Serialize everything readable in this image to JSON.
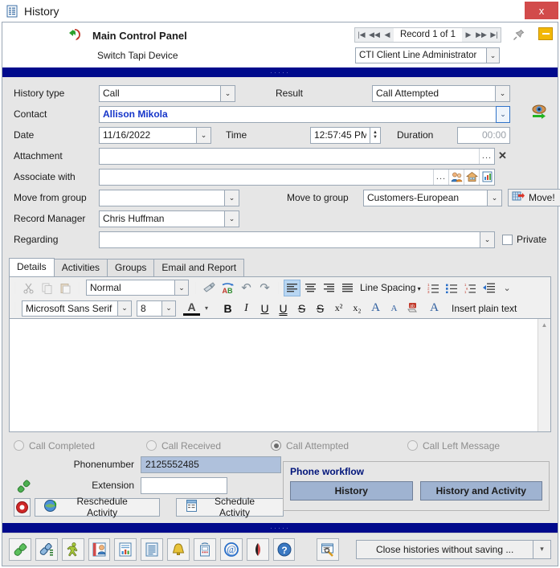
{
  "window": {
    "title": "History",
    "icon": "document-history-icon",
    "close_label": "x"
  },
  "header": {
    "title": "Main Control Panel",
    "subtitle": "Switch Tapi Device",
    "phone_icon": "green-phone-arrow-icon",
    "record_nav": {
      "first": "|◀",
      "prev_page": "◀◀",
      "prev": "◀",
      "label": "Record 1 of 1",
      "next": "▶",
      "next_page": "▶▶",
      "last": "▶|"
    },
    "pin_icon": "pushpin-icon",
    "minimize_icon": "minimize-icon",
    "device_select": {
      "value": "CTI Client Line Administrator",
      "placeholder": ""
    }
  },
  "form": {
    "history_type": {
      "label": "History type",
      "value": "Call"
    },
    "result": {
      "label": "Result",
      "value": "Call Attempted"
    },
    "contact": {
      "label": "Contact",
      "value": "Allison Mikola"
    },
    "date": {
      "label": "Date",
      "value": "11/16/2022"
    },
    "time": {
      "label": "Time",
      "value": "12:57:45 PM"
    },
    "duration": {
      "label": "Duration",
      "value": "00:00"
    },
    "attachment": {
      "label": "Attachment",
      "value": "",
      "browse": "...",
      "clear": "✕"
    },
    "associate_with": {
      "label": "Associate with",
      "value": "",
      "browse": "..."
    },
    "move_from_group": {
      "label": "Move from group",
      "value": ""
    },
    "move_to_group": {
      "label": "Move to group",
      "value": "Customers-European"
    },
    "move_button": {
      "label": "Move!",
      "icon": "move-grid-icon"
    },
    "record_manager": {
      "label": "Record Manager",
      "value": "Chris Huffman"
    },
    "regarding": {
      "label": "Regarding",
      "value": ""
    },
    "private": {
      "label": "Private",
      "checked": false
    },
    "eye_icon": "eye-forward-icon"
  },
  "tabs": [
    {
      "label": "Details",
      "active": true
    },
    {
      "label": "Activities",
      "active": false
    },
    {
      "label": "Groups",
      "active": false
    },
    {
      "label": "Email and Report",
      "active": false
    }
  ],
  "editor_toolbar": {
    "cut": "✂",
    "copy": "copy-icon",
    "paste": "paste-icon",
    "style": "Normal",
    "format_painter": "format-painter-icon",
    "spellcheck": "spellcheck-icon",
    "undo": "↶",
    "redo": "↷",
    "align_left": "align-left-icon",
    "align_center": "align-center-icon",
    "align_right": "align-right-icon",
    "align_justify": "align-justify-icon",
    "line_spacing": "Line Spacing",
    "numbered_list": "numbered-list-icon",
    "bullet_list": "bullet-list-icon",
    "multilevel_list": "multilevel-list-icon",
    "indent": "indent-icon",
    "overflow": "⌄",
    "font_family": "Microsoft Sans Serif",
    "font_size": "8",
    "font_color": "A",
    "bold": "B",
    "italic": "I",
    "underline": "U",
    "double_underline": "U",
    "strikethrough": "S",
    "double_strikethrough": "S",
    "superscript": "x²",
    "subscript": "x₂",
    "grow_font": "A",
    "shrink_font": "A",
    "highlight": "highlight-icon",
    "clear_format": "A",
    "insert_plain_text": "Insert plain text"
  },
  "editor": {
    "content": ""
  },
  "call_options": [
    {
      "label": "Call Completed",
      "selected": false
    },
    {
      "label": "Call Received",
      "selected": false
    },
    {
      "label": "Call Attempted",
      "selected": true
    },
    {
      "label": "Call Left Message",
      "selected": false
    }
  ],
  "phone": {
    "number_label": "Phonenumber",
    "number_value": "2125552485",
    "extension_label": "Extension",
    "extension_value": "",
    "handset_icon": "green-handset-icon",
    "cancel_icon": "red-stop-icon",
    "reschedule": {
      "label": "Reschedule Activity",
      "icon": "reschedule-globe-icon"
    },
    "schedule": {
      "label": "Schedule Activity",
      "icon": "schedule-calendar-icon"
    }
  },
  "workflow": {
    "title": "Phone workflow",
    "buttons": [
      {
        "label": "History"
      },
      {
        "label": "History and Activity"
      }
    ]
  },
  "bottom_toolbar": {
    "icons": [
      "phone-icon",
      "phone-dial-icon",
      "person-walking-icon",
      "contact-card-icon",
      "report-icon",
      "document-icon",
      "bell-icon",
      "fax-icon",
      "email-icon",
      "pen-icon",
      "help-icon"
    ],
    "search_icon": "lookup-icon",
    "close_action": {
      "label": "Close histories without saving ...",
      "arrow": "▾"
    }
  },
  "colors": {
    "blue_bar": "#000a8c",
    "accent_link": "#1535c9",
    "workflow_button": "#9fb3d1",
    "phone_field": "#afc1dc",
    "close_red": "#d24b4b"
  }
}
